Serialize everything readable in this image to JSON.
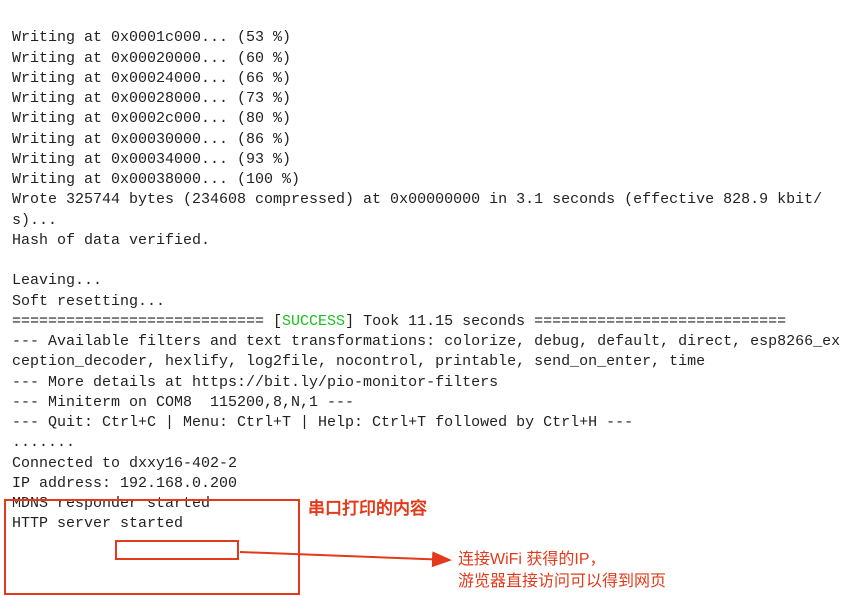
{
  "terminal": {
    "lines": [
      "Writing at 0x0001c000... (53 %)",
      "Writing at 0x00020000... (60 %)",
      "Writing at 0x00024000... (66 %)",
      "Writing at 0x00028000... (73 %)",
      "Writing at 0x0002c000... (80 %)",
      "Writing at 0x00030000... (86 %)",
      "Writing at 0x00034000... (93 %)",
      "Writing at 0x00038000... (100 %)",
      "Wrote 325744 bytes (234608 compressed) at 0x00000000 in 3.1 seconds (effective 828.9 kbit/s)...",
      "Hash of data verified.",
      "",
      "Leaving...",
      "Soft resetting..."
    ],
    "success_prefix": "============================ [",
    "success_word": "SUCCESS",
    "success_suffix": "] Took 11.15 seconds ============================",
    "lines2": [
      "--- Available filters and text transformations: colorize, debug, default, direct, esp8266_exception_decoder, hexlify, log2file, nocontrol, printable, send_on_enter, time",
      "--- More details at https://bit.ly/pio-monitor-filters",
      "--- Miniterm on COM8  115200,8,N,1 ---",
      "--- Quit: Ctrl+C | Menu: Ctrl+T | Help: Ctrl+T followed by Ctrl+H ---",
      ".......",
      "Connected to dxxy16-402-2",
      "IP address: 192.168.0.200",
      "MDNS responder started",
      "HTTP server started"
    ]
  },
  "annotations": {
    "title": "串口打印的内容",
    "desc1": "连接WiFi 获得的IP，",
    "desc2": "游览器直接访问可以得到网页",
    "ip_highlight": "192.168.0.200"
  }
}
